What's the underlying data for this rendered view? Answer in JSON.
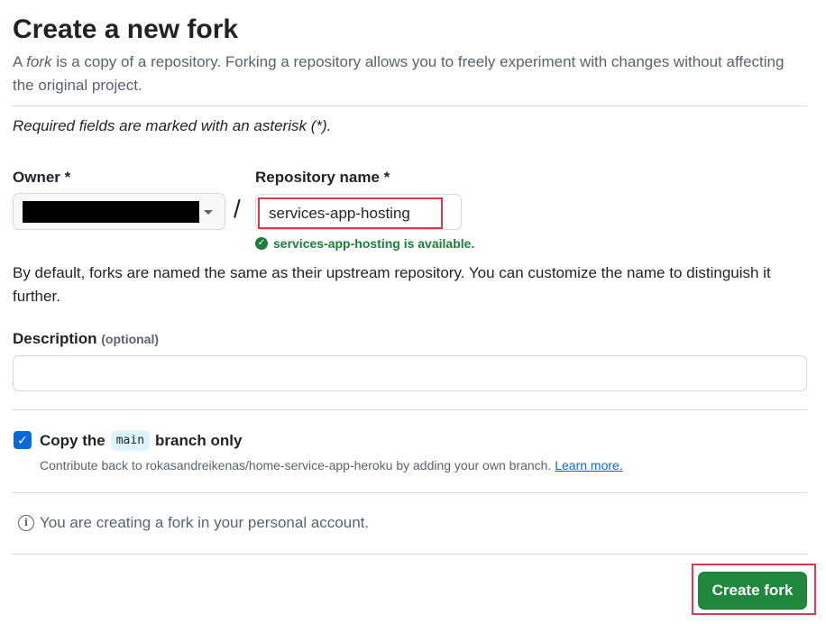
{
  "header": {
    "title": "Create a new fork",
    "intro_pre": "A ",
    "intro_em": "fork",
    "intro_post": " is a copy of a repository. Forking a repository allows you to freely experiment with changes without affecting the original project."
  },
  "form": {
    "required_note": "Required fields are marked with an asterisk (*).",
    "owner": {
      "label": "Owner *",
      "value": ""
    },
    "separator": "/",
    "repo": {
      "label": "Repository name *",
      "value": "services-app-hosting",
      "availability": "services-app-hosting is available."
    },
    "naming_help": "By default, forks are named the same as their upstream repository. You can customize the name to distinguish it further.",
    "description": {
      "label": "Description",
      "optional": "(optional)",
      "value": ""
    },
    "copy_branch": {
      "checked": true,
      "label_pre": "Copy the",
      "branch": "main",
      "label_post": "branch only",
      "help": "Contribute back to rokasandreikenas/home-service-app-heroku by adding your own branch.",
      "learn_more": "Learn more."
    },
    "info": "You are creating a fork in your personal account.",
    "submit_label": "Create fork"
  },
  "colors": {
    "primary_button": "#1f883d",
    "success_text": "#1a7f37",
    "link": "#0969da",
    "highlight_box": "#d73a49"
  }
}
